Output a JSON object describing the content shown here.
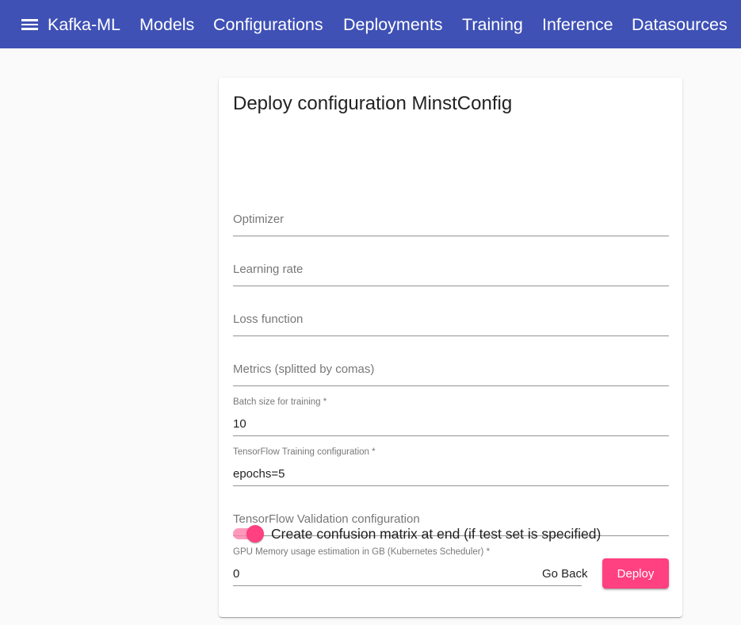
{
  "toolbar": {
    "menu_icon": "menu-icon",
    "brand": "Kafka-ML",
    "nav": [
      {
        "label": "Models"
      },
      {
        "label": "Configurations"
      },
      {
        "label": "Deployments"
      },
      {
        "label": "Training"
      },
      {
        "label": "Inference"
      },
      {
        "label": "Datasources"
      }
    ],
    "color": "#3f51b5"
  },
  "form": {
    "title": "Deploy configuration MinstConfig",
    "fields": [
      {
        "label": "Optimizer",
        "value": ""
      },
      {
        "label": "Learning rate",
        "value": ""
      },
      {
        "label": "Loss function",
        "value": ""
      },
      {
        "label": "Metrics (splitted by comas)",
        "value": ""
      },
      {
        "label": "Batch size for training *",
        "value": "10"
      },
      {
        "label": "TensorFlow Training configuration *",
        "value": "epochs=5"
      },
      {
        "label": "TensorFlow Validation configuration",
        "value": ""
      },
      {
        "label": "GPU Memory usage estimation in GB (Kubernetes Scheduler) *",
        "value": "0"
      }
    ],
    "toggle": {
      "label": "Create confusion matrix at end (if test set is specified)",
      "checked": true
    },
    "back_label": "Go Back",
    "deploy_label": "Deploy",
    "accent": "#ff4081"
  }
}
